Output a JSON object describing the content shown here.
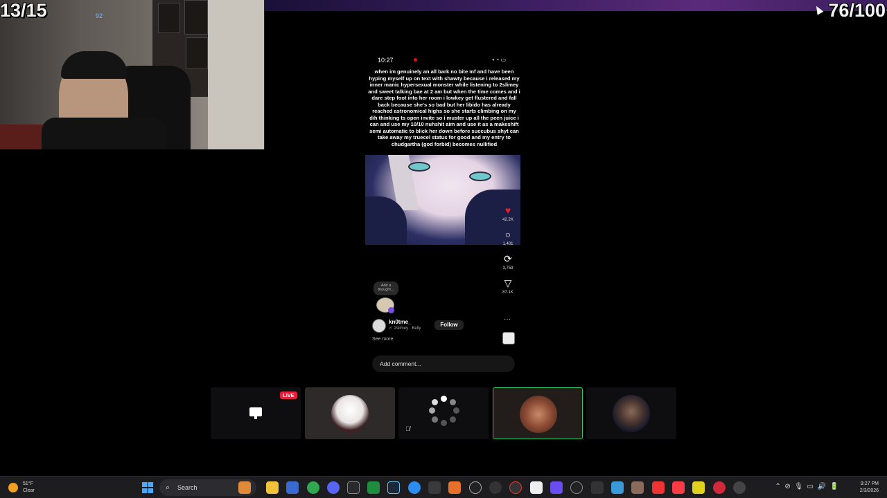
{
  "overlay": {
    "left_counter": "13/15",
    "right_counter": "76/100"
  },
  "webcam": {
    "tag": "92"
  },
  "phone": {
    "status_time": "10:27",
    "status_right": "",
    "caption": "when im genuinely an all bark no bite mf and have been hyping myself up on text with shawty because i released my inner manic hypersexual monster while listening to 2slimey and sweet talking bae at 2 am but when the time comes and i dare step foot into her room i lowkey get flustered and fall back because she's so bad but her libido has already reached astronomical highs so she starts climbing on my dih thinking ts open invite so i muster up all the peen juice i can and use my 10/10 nuhshit aim and use it as a makeshift semi automatic to blick her down before succubus shyt can take away my truecel status for good and my entry to chudgartha (god forbid) becomes nullified",
    "actions": {
      "likes": "42.2K",
      "comments": "1,401",
      "reposts": "3,759",
      "shares": "87.1K"
    },
    "thought_prompt": "Add a thought...",
    "author": {
      "name": "kn0tme_",
      "sound": "♬ 2slimey · Belly"
    },
    "follow_label": "Follow",
    "more_label": "···",
    "see_more": "See more",
    "comment_placeholder": "Add comment..."
  },
  "tiles": {
    "live_badge": "LIVE"
  },
  "taskbar": {
    "weather_temp": "51°F",
    "weather_cond": "Clear",
    "search_label": "Search",
    "clock_time": "9:27 PM",
    "clock_date": "2/3/2026"
  },
  "colors": {
    "like": "#e8202a",
    "live": "#e5203a",
    "active_tile_border": "#2ec86a",
    "accent": "#4aa8ff"
  }
}
